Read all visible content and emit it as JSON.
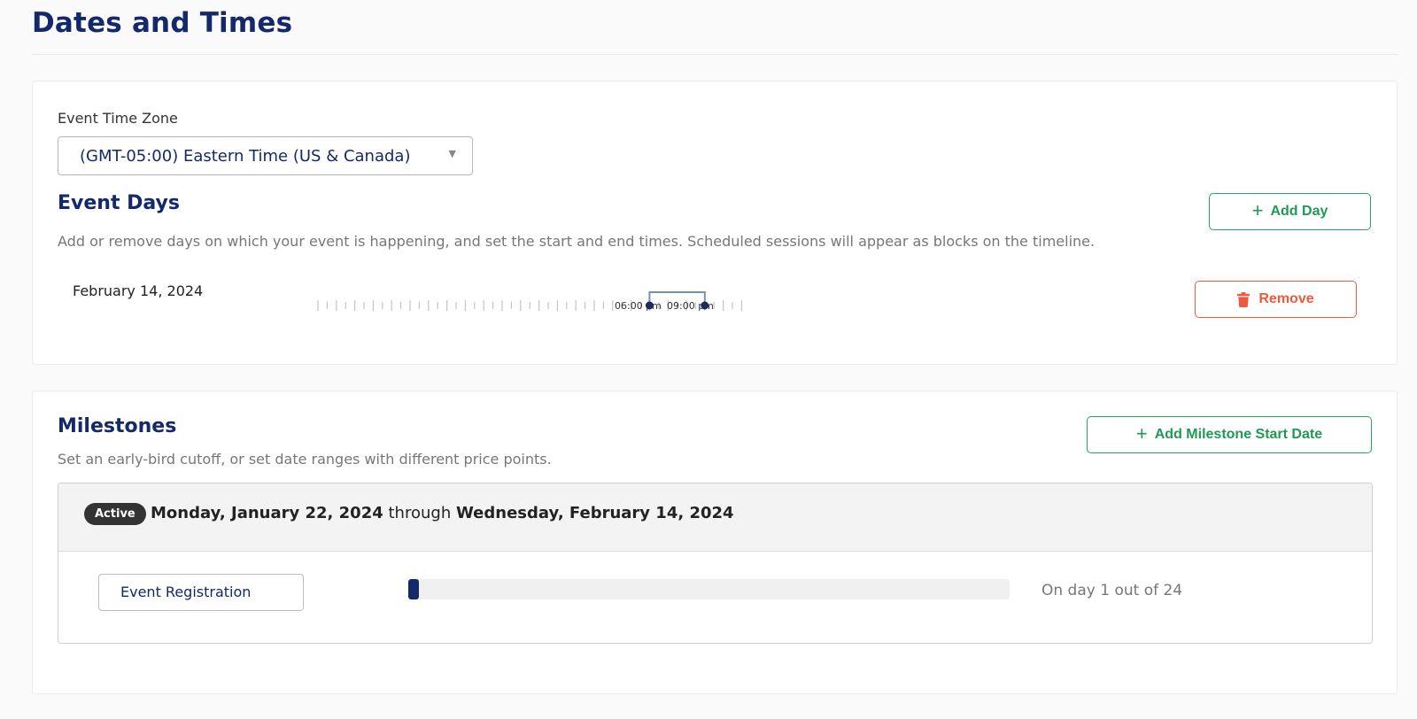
{
  "page": {
    "title": "Dates and Times"
  },
  "timezone": {
    "label": "Event Time Zone",
    "value": "(GMT-05:00) Eastern Time (US & Canada)"
  },
  "event_days": {
    "title": "Event Days",
    "description": "Add or remove days on which your event is happening, and set the start and end times. Scheduled sessions will appear as blocks on the timeline.",
    "add_button_label": "Add Day",
    "days": [
      {
        "date": "February 14, 2024",
        "start_time": "06:00 pm",
        "end_time": "09:00 pm",
        "remove_label": "Remove"
      }
    ]
  },
  "milestones": {
    "title": "Milestones",
    "description": "Set an early-bird cutoff, or set date ranges with different price points.",
    "add_button_label": "Add Milestone Start Date",
    "ranges": [
      {
        "status": "Active",
        "start": "Monday, January 22, 2024",
        "connector": "through",
        "end": "Wednesday, February 14, 2024",
        "item_label": "Event Registration",
        "progress_text": "On day 1 out of 24",
        "progress_current": 1,
        "progress_total": 24
      }
    ]
  },
  "colors": {
    "brand_navy": "#14296b",
    "success_green": "#1f9a55",
    "danger_red": "#ef5a3c"
  },
  "icons": {
    "add": "plus-icon",
    "remove": "trash-icon",
    "dropdown": "caret-down-icon"
  }
}
